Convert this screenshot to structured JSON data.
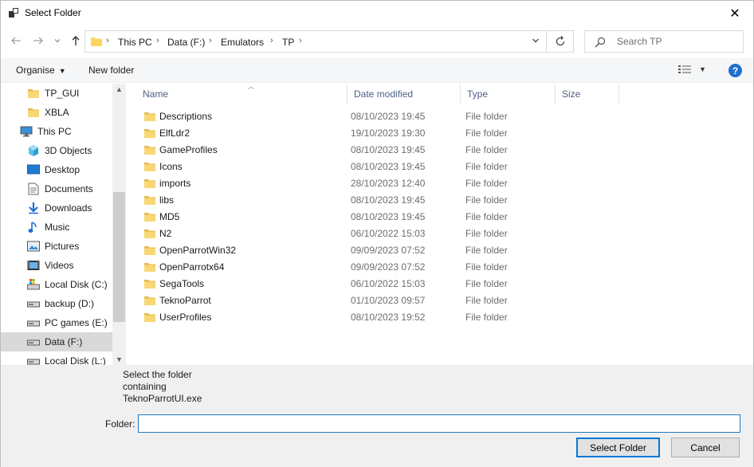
{
  "window": {
    "title": "Select Folder",
    "close_glyph": "✕"
  },
  "address": {
    "breadcrumbs": [
      "This PC",
      "Data (F:)",
      "Emulators",
      "TP"
    ],
    "search_placeholder": "Search TP"
  },
  "toolbar": {
    "organise_label": "Organise",
    "new_folder_label": "New folder",
    "help_label": "?"
  },
  "navpane": {
    "items": [
      {
        "label": "TP_GUI",
        "icon": "folder-icon",
        "indent": 1
      },
      {
        "label": "XBLA",
        "icon": "folder-icon",
        "indent": 1
      },
      {
        "label": "This PC",
        "icon": "computer-icon",
        "indent": 0
      },
      {
        "label": "3D Objects",
        "icon": "cube-icon",
        "indent": 1
      },
      {
        "label": "Desktop",
        "icon": "desktop-icon",
        "indent": 1
      },
      {
        "label": "Documents",
        "icon": "document-icon",
        "indent": 1
      },
      {
        "label": "Downloads",
        "icon": "download-icon",
        "indent": 1
      },
      {
        "label": "Music",
        "icon": "music-icon",
        "indent": 1
      },
      {
        "label": "Pictures",
        "icon": "pictures-icon",
        "indent": 1
      },
      {
        "label": "Videos",
        "icon": "videos-icon",
        "indent": 1
      },
      {
        "label": "Local Disk (C:)",
        "icon": "system-drive-icon",
        "indent": 1
      },
      {
        "label": "backup (D:)",
        "icon": "drive-icon",
        "indent": 1
      },
      {
        "label": "PC games (E:)",
        "icon": "drive-icon",
        "indent": 1
      },
      {
        "label": "Data (F:)",
        "icon": "drive-icon",
        "indent": 1,
        "selected": true
      },
      {
        "label": "Local Disk (L:)",
        "icon": "drive-icon",
        "indent": 1
      }
    ]
  },
  "filelist": {
    "columns": {
      "name": "Name",
      "date": "Date modified",
      "type": "Type",
      "size": "Size"
    },
    "rows": [
      {
        "name": "Descriptions",
        "date": "08/10/2023 19:45",
        "type": "File folder"
      },
      {
        "name": "ElfLdr2",
        "date": "19/10/2023 19:30",
        "type": "File folder"
      },
      {
        "name": "GameProfiles",
        "date": "08/10/2023 19:45",
        "type": "File folder"
      },
      {
        "name": "Icons",
        "date": "08/10/2023 19:45",
        "type": "File folder"
      },
      {
        "name": "imports",
        "date": "28/10/2023 12:40",
        "type": "File folder"
      },
      {
        "name": "libs",
        "date": "08/10/2023 19:45",
        "type": "File folder"
      },
      {
        "name": "MD5",
        "date": "08/10/2023 19:45",
        "type": "File folder"
      },
      {
        "name": "N2",
        "date": "06/10/2022 15:03",
        "type": "File folder"
      },
      {
        "name": "OpenParrotWin32",
        "date": "09/09/2023 07:52",
        "type": "File folder"
      },
      {
        "name": "OpenParrotx64",
        "date": "09/09/2023 07:52",
        "type": "File folder"
      },
      {
        "name": "SegaTools",
        "date": "06/10/2022 15:03",
        "type": "File folder"
      },
      {
        "name": "TeknoParrot",
        "date": "01/10/2023 09:57",
        "type": "File folder"
      },
      {
        "name": "UserProfiles",
        "date": "08/10/2023 19:52",
        "type": "File folder"
      }
    ]
  },
  "bottom": {
    "description": "Select the folder\ncontaining\nTeknoParrotUI.exe",
    "folder_label": "Folder:",
    "folder_value": "",
    "select_button": "Select Folder",
    "cancel_button": "Cancel"
  },
  "colors": {
    "folder_yellow": "#f8d775",
    "accent_blue": "#0078d7",
    "selected_bg": "#d9d9d9",
    "header_text": "#4d6082"
  }
}
